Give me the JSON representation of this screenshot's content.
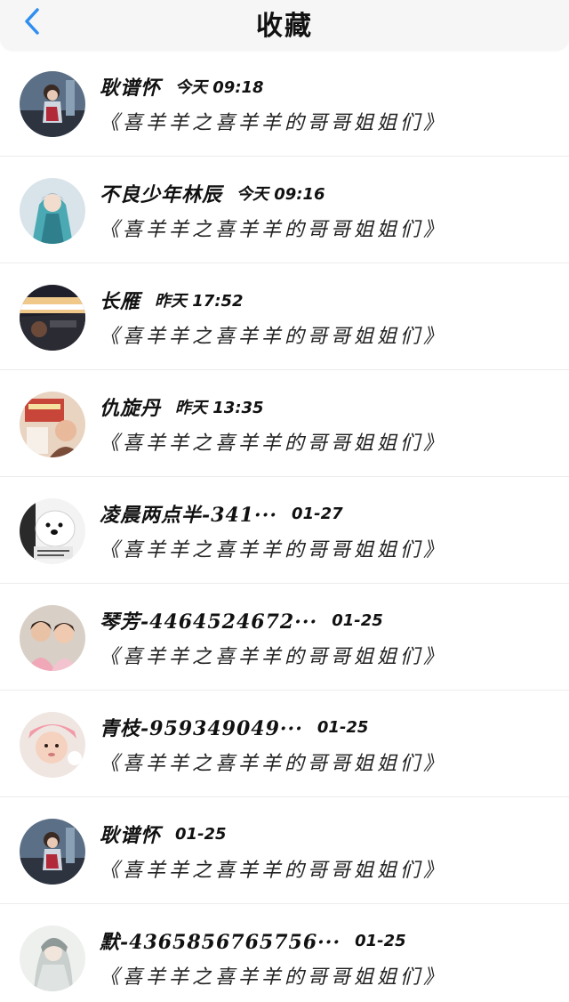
{
  "header": {
    "title": "收藏",
    "back_icon": "chevron-left-icon",
    "accent_color": "#2f8ef0"
  },
  "items": [
    {
      "name": "耿谱怀",
      "time": "今天 09:18",
      "message": "《喜羊羊之喜羊羊的哥哥姐姐们》",
      "avatar": "girl-figure-avatar"
    },
    {
      "name": "不良少年林辰",
      "time": "今天 09:16",
      "message": "《喜羊羊之喜羊羊的哥哥姐姐们》",
      "avatar": "anime-character-avatar"
    },
    {
      "name": "长雁",
      "time": "昨天 17:52",
      "message": "《喜羊羊之喜羊羊的哥哥姐姐们》",
      "avatar": "car-interior-avatar"
    },
    {
      "name": "仇旋丹",
      "time": "昨天 13:35",
      "message": "《喜羊羊之喜羊羊的哥哥姐姐们》",
      "avatar": "birthday-avatar"
    },
    {
      "name": "凌晨两点半-341···",
      "time": "01-27",
      "message": "《喜羊羊之喜羊羊的哥哥姐姐们》",
      "avatar": "polar-bear-avatar"
    },
    {
      "name": "琴芳-4464524672···",
      "time": "01-25",
      "message": "《喜羊羊之喜羊羊的哥哥姐姐们》",
      "avatar": "two-kids-avatar"
    },
    {
      "name": "青枝-959349049···",
      "time": "01-25",
      "message": "《喜羊羊之喜羊羊的哥哥姐姐们》",
      "avatar": "baby-avatar"
    },
    {
      "name": "耿谱怀",
      "time": "01-25",
      "message": "《喜羊羊之喜羊羊的哥哥姐姐们》",
      "avatar": "girl-figure-avatar"
    },
    {
      "name": "默-4365856765756···",
      "time": "01-25",
      "message": "《喜羊羊之喜羊羊的哥哥姐姐们》",
      "avatar": "ink-portrait-avatar"
    }
  ]
}
